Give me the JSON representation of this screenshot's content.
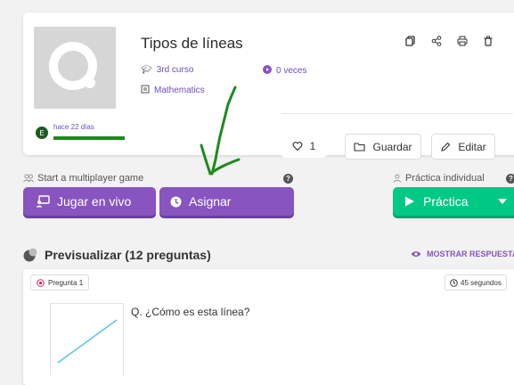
{
  "quiz": {
    "title": "Tipos de líneas",
    "grade": "3rd curso",
    "subject": "Mathematics",
    "plays": "0 veces",
    "created": "hace 22 días",
    "author_initial": "E",
    "likes": "1",
    "save_label": "Guardar",
    "edit_label": "Editar"
  },
  "actions": {
    "multiplayer_label": "Start a multiplayer game",
    "live_label": "Jugar en vivo",
    "assign_label": "Asignar",
    "individual_label": "Práctica individual",
    "practice_label": "Práctica"
  },
  "preview": {
    "title": "Previsualizar (12 preguntas)",
    "show_answers": "MOSTRAR RESPUESTAS",
    "question": {
      "badge": "Pregunta 1",
      "time": "45 segundos",
      "text": "Q. ¿Cómo es esta línea?"
    }
  },
  "colors": {
    "purple": "#8854c0",
    "green": "#00c985",
    "annotation": "#1e8a1e"
  },
  "icons": [
    "copy-icon",
    "share-icon",
    "print-icon",
    "trash-icon",
    "cap-icon",
    "play-icon",
    "book-icon",
    "heart-icon",
    "folder-icon",
    "pencil-icon",
    "users-icon",
    "present-icon",
    "clock-icon",
    "person-icon",
    "triangle-play-icon",
    "caret-down-icon",
    "help-icon",
    "eye-icon",
    "target-icon"
  ]
}
